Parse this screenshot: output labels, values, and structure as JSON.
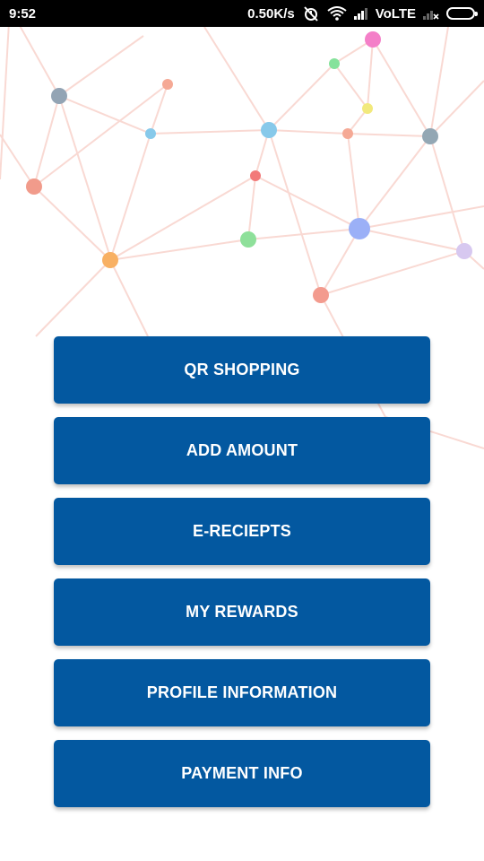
{
  "status_bar": {
    "time": "9:52",
    "network_speed": "0.50K/s",
    "network_type": "VoLTE",
    "icons": [
      "alarm-off-icon",
      "wifi-icon",
      "signal-icon",
      "no-signal-icon",
      "battery-icon"
    ]
  },
  "menu": {
    "items": [
      {
        "label": "QR SHOPPING"
      },
      {
        "label": "ADD AMOUNT"
      },
      {
        "label": "E-RECIEPTS"
      },
      {
        "label": "MY REWARDS"
      },
      {
        "label": "PROFILE INFORMATION"
      },
      {
        "label": "PAYMENT INFO"
      }
    ]
  },
  "colors": {
    "button_bg": "#0358a0",
    "button_text": "#ffffff",
    "status_bar_bg": "#000000",
    "network_lines": "#f9d9d3"
  },
  "background": {
    "type": "network-graph-decoration",
    "node_colors": [
      "#f47fc8",
      "#86e29b",
      "#93a4b4",
      "#f5a995",
      "#f2e97c",
      "#87c9ea",
      "#93a7b4",
      "#f19b8b",
      "#f27a7a",
      "#8ee09a",
      "#9bb0f7",
      "#f8b063",
      "#f39b8e",
      "#d7c8f0"
    ]
  }
}
